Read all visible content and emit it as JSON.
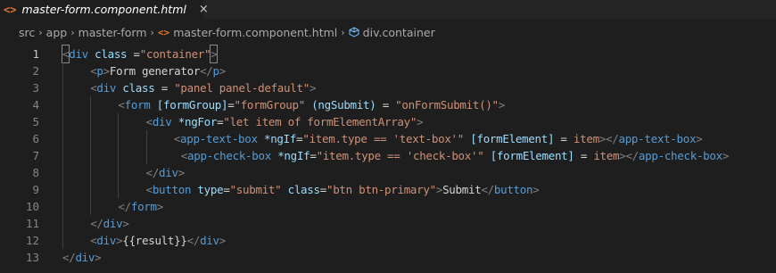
{
  "tab": {
    "icon": "<>",
    "title": "master-form.component.html",
    "close": "×"
  },
  "breadcrumb": {
    "items": [
      "src",
      "app",
      "master-form",
      "master-form.component.html",
      "div.container"
    ],
    "separator": "›"
  },
  "editor": {
    "line_numbers": [
      "1",
      "2",
      "3",
      "4",
      "5",
      "6",
      "7",
      "8",
      "9",
      "10",
      "11",
      "12",
      "13"
    ],
    "active_line": 1,
    "lines": [
      {
        "indent": 0,
        "tokens": [
          {
            "t": "punc",
            "v": "<"
          },
          {
            "t": "tag",
            "v": "div"
          },
          {
            "t": "text",
            "v": " "
          },
          {
            "t": "attr",
            "v": "class"
          },
          {
            "t": "text",
            "v": " "
          },
          {
            "t": "eq",
            "v": "="
          },
          {
            "t": "str",
            "v": "\"container\""
          },
          {
            "t": "punc",
            "v": ">"
          }
        ]
      },
      {
        "indent": 1,
        "tokens": [
          {
            "t": "punc",
            "v": "<"
          },
          {
            "t": "tag",
            "v": "p"
          },
          {
            "t": "punc",
            "v": ">"
          },
          {
            "t": "text",
            "v": "Form generator"
          },
          {
            "t": "punc",
            "v": "</"
          },
          {
            "t": "tag",
            "v": "p"
          },
          {
            "t": "punc",
            "v": ">"
          }
        ]
      },
      {
        "indent": 1,
        "tokens": [
          {
            "t": "punc",
            "v": "<"
          },
          {
            "t": "tag",
            "v": "div"
          },
          {
            "t": "text",
            "v": " "
          },
          {
            "t": "attr",
            "v": "class"
          },
          {
            "t": "text",
            "v": " "
          },
          {
            "t": "eq",
            "v": "="
          },
          {
            "t": "text",
            "v": " "
          },
          {
            "t": "str",
            "v": "\"panel panel-default\""
          },
          {
            "t": "punc",
            "v": ">"
          }
        ]
      },
      {
        "indent": 2,
        "tokens": [
          {
            "t": "punc",
            "v": "<"
          },
          {
            "t": "tag",
            "v": "form"
          },
          {
            "t": "text",
            "v": " "
          },
          {
            "t": "attr",
            "v": "[formGroup]"
          },
          {
            "t": "eq",
            "v": "="
          },
          {
            "t": "str",
            "v": "\"formGroup\""
          },
          {
            "t": "text",
            "v": " "
          },
          {
            "t": "attr",
            "v": "(ngSubmit)"
          },
          {
            "t": "text",
            "v": " "
          },
          {
            "t": "eq",
            "v": "="
          },
          {
            "t": "text",
            "v": " "
          },
          {
            "t": "str",
            "v": "\"onFormSubmit()\""
          },
          {
            "t": "punc",
            "v": ">"
          }
        ]
      },
      {
        "indent": 3,
        "tokens": [
          {
            "t": "punc",
            "v": "<"
          },
          {
            "t": "tag",
            "v": "div"
          },
          {
            "t": "text",
            "v": " "
          },
          {
            "t": "attr",
            "v": "*ngFor"
          },
          {
            "t": "eq",
            "v": "="
          },
          {
            "t": "str",
            "v": "\"let item of formElementArray\""
          },
          {
            "t": "punc",
            "v": ">"
          }
        ]
      },
      {
        "indent": 4,
        "extra": 0,
        "tokens": [
          {
            "t": "punc",
            "v": "<"
          },
          {
            "t": "tag",
            "v": "app-text-box"
          },
          {
            "t": "text",
            "v": " "
          },
          {
            "t": "attr",
            "v": "*ngIf"
          },
          {
            "t": "eq",
            "v": "="
          },
          {
            "t": "str",
            "v": "\"item.type == 'text-box'\""
          },
          {
            "t": "text",
            "v": " "
          },
          {
            "t": "attr",
            "v": "[formElement]"
          },
          {
            "t": "text",
            "v": " "
          },
          {
            "t": "eq",
            "v": "="
          },
          {
            "t": "text",
            "v": " "
          },
          {
            "t": "str",
            "v": "item"
          },
          {
            "t": "punc",
            "v": "></"
          },
          {
            "t": "tag",
            "v": "app-text-box"
          },
          {
            "t": "punc",
            "v": ">"
          }
        ]
      },
      {
        "indent": 4,
        "extra": 1,
        "tokens": [
          {
            "t": "punc",
            "v": "<"
          },
          {
            "t": "tag",
            "v": "app-check-box"
          },
          {
            "t": "text",
            "v": " "
          },
          {
            "t": "attr",
            "v": "*ngIf"
          },
          {
            "t": "eq",
            "v": "="
          },
          {
            "t": "str",
            "v": "\"item.type == 'check-box'\""
          },
          {
            "t": "text",
            "v": " "
          },
          {
            "t": "attr",
            "v": "[formElement]"
          },
          {
            "t": "text",
            "v": " "
          },
          {
            "t": "eq",
            "v": "="
          },
          {
            "t": "text",
            "v": " "
          },
          {
            "t": "str",
            "v": "item"
          },
          {
            "t": "punc",
            "v": "></"
          },
          {
            "t": "tag",
            "v": "app-check-box"
          },
          {
            "t": "punc",
            "v": ">"
          }
        ]
      },
      {
        "indent": 3,
        "tokens": [
          {
            "t": "punc",
            "v": "</"
          },
          {
            "t": "tag",
            "v": "div"
          },
          {
            "t": "punc",
            "v": ">"
          }
        ]
      },
      {
        "indent": 3,
        "tokens": [
          {
            "t": "punc",
            "v": "<"
          },
          {
            "t": "tag",
            "v": "button"
          },
          {
            "t": "text",
            "v": " "
          },
          {
            "t": "attr",
            "v": "type"
          },
          {
            "t": "eq",
            "v": "="
          },
          {
            "t": "str",
            "v": "\"submit\""
          },
          {
            "t": "text",
            "v": " "
          },
          {
            "t": "attr",
            "v": "class"
          },
          {
            "t": "eq",
            "v": "="
          },
          {
            "t": "str",
            "v": "\"btn btn-primary\""
          },
          {
            "t": "punc",
            "v": ">"
          },
          {
            "t": "text",
            "v": "Submit"
          },
          {
            "t": "punc",
            "v": "</"
          },
          {
            "t": "tag",
            "v": "button"
          },
          {
            "t": "punc",
            "v": ">"
          }
        ]
      },
      {
        "indent": 2,
        "tokens": [
          {
            "t": "punc",
            "v": "</"
          },
          {
            "t": "tag",
            "v": "form"
          },
          {
            "t": "punc",
            "v": ">"
          }
        ]
      },
      {
        "indent": 1,
        "tokens": [
          {
            "t": "punc",
            "v": "</"
          },
          {
            "t": "tag",
            "v": "div"
          },
          {
            "t": "punc",
            "v": ">"
          }
        ]
      },
      {
        "indent": 1,
        "tokens": [
          {
            "t": "punc",
            "v": "<"
          },
          {
            "t": "tag",
            "v": "div"
          },
          {
            "t": "punc",
            "v": ">"
          },
          {
            "t": "text",
            "v": "{{result}}"
          },
          {
            "t": "punc",
            "v": "</"
          },
          {
            "t": "tag",
            "v": "div"
          },
          {
            "t": "punc",
            "v": ">"
          }
        ]
      },
      {
        "indent": 0,
        "tokens": [
          {
            "t": "punc",
            "v": "</"
          },
          {
            "t": "tag",
            "v": "div"
          },
          {
            "t": "punc",
            "v": ">"
          }
        ]
      }
    ]
  },
  "colors": {
    "background": "#1e1e1e",
    "tag": "#569cd6",
    "attribute": "#9cdcfe",
    "string": "#ce9178",
    "punctuation": "#808080",
    "html_icon": "#e37933"
  }
}
